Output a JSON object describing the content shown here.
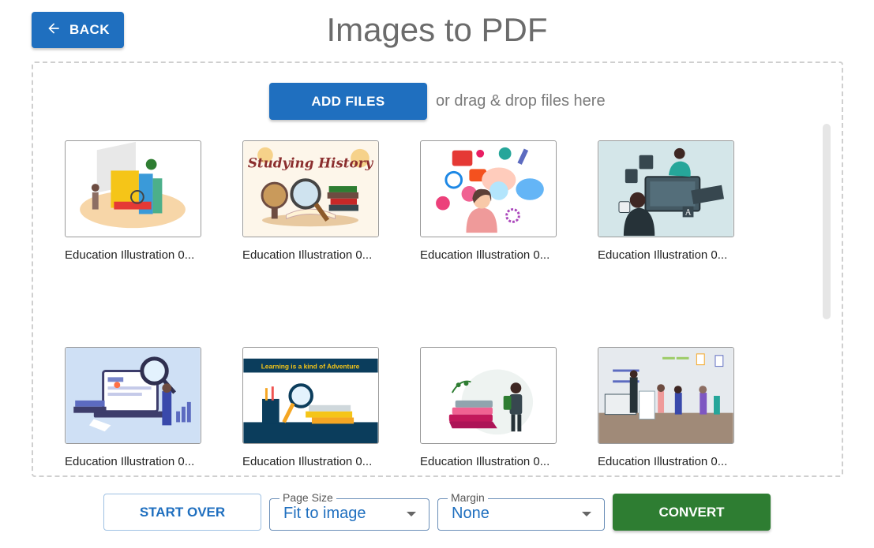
{
  "header": {
    "back_label": "BACK",
    "title": "Images to PDF"
  },
  "upload": {
    "add_files_label": "ADD FILES",
    "drop_hint": "or drag & drop files here"
  },
  "files": [
    {
      "name": "Education Illustration 0...",
      "thumb_caption": ""
    },
    {
      "name": "Education Illustration 0...",
      "thumb_caption": "Studying History"
    },
    {
      "name": "Education Illustration 0...",
      "thumb_caption": ""
    },
    {
      "name": "Education Illustration 0...",
      "thumb_caption": ""
    },
    {
      "name": "Education Illustration 0...",
      "thumb_caption": ""
    },
    {
      "name": "Education Illustration 0...",
      "thumb_caption": "Learning is a kind of Adventure"
    },
    {
      "name": "Education Illustration 0...",
      "thumb_caption": ""
    },
    {
      "name": "Education Illustration 0...",
      "thumb_caption": ""
    }
  ],
  "footer": {
    "start_over_label": "START OVER",
    "page_size": {
      "legend": "Page Size",
      "value": "Fit to image"
    },
    "margin": {
      "legend": "Margin",
      "value": "None"
    },
    "convert_label": "CONVERT"
  },
  "colors": {
    "primary": "#1f6fbf",
    "convert": "#2e7d32",
    "title": "#6b6b6b"
  }
}
